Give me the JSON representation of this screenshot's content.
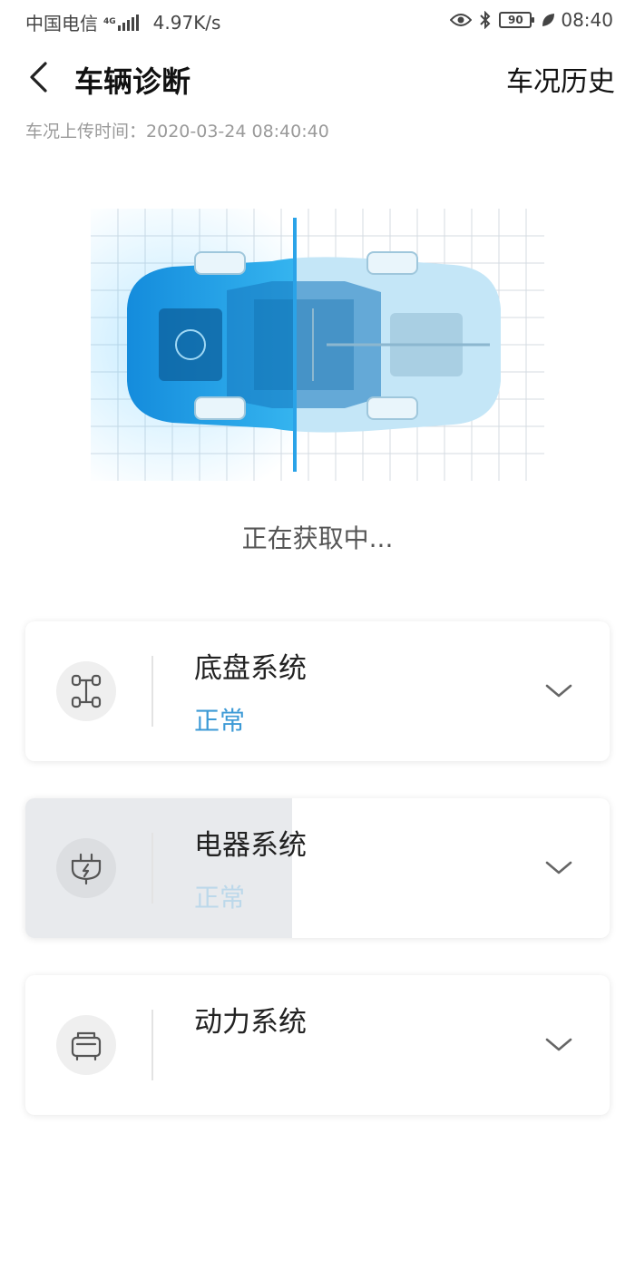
{
  "status_bar": {
    "carrier": "中国电信",
    "network": "4G",
    "speed": "4.97K/s",
    "battery": "90",
    "time": "08:40"
  },
  "header": {
    "title": "车辆诊断",
    "history_label": "车况历史"
  },
  "upload": {
    "label": "车况上传时间：",
    "time": "2020-03-24 08:40:40"
  },
  "status_text": "正在获取中...",
  "systems": [
    {
      "name": "底盘系统",
      "state": "正常",
      "icon": "chassis-icon"
    },
    {
      "name": "电器系统",
      "state": "正常",
      "icon": "electric-plug-icon"
    },
    {
      "name": "动力系统",
      "state": "",
      "icon": "engine-icon"
    }
  ],
  "colors": {
    "accent": "#3c9ad6",
    "car_blue": "#1e9be0",
    "card_pressed": "#e8eaed"
  }
}
